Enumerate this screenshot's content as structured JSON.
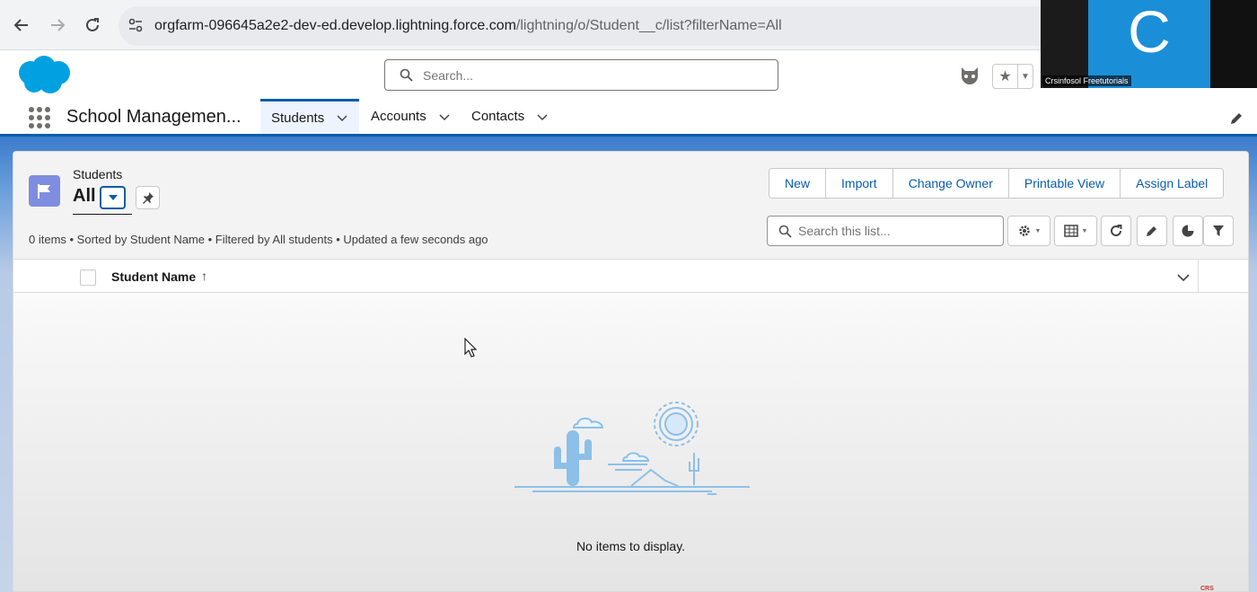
{
  "browser": {
    "url_main": "orgfarm-096645a2e2-dev-ed.develop.lightning.force.com",
    "url_path": "/lightning/o/Student__c/list?filterName=All"
  },
  "header": {
    "search_placeholder": "Search..."
  },
  "video_overlay": {
    "initial": "C",
    "name": "Crsinfosol Freetutorials"
  },
  "app_nav": {
    "app_name": "School Managemen...",
    "tabs": [
      {
        "label": "Students",
        "active": true
      },
      {
        "label": "Accounts",
        "active": false
      },
      {
        "label": "Contacts",
        "active": false
      }
    ]
  },
  "list_view": {
    "object_label": "Students",
    "view_name": "All",
    "info": "0 items • Sorted by Student Name • Filtered by All students • Updated a few seconds ago",
    "actions": [
      "New",
      "Import",
      "Change Owner",
      "Printable View",
      "Assign Label"
    ],
    "search_placeholder": "Search this list...",
    "columns": [
      {
        "label": "Student Name",
        "sort": "ascending"
      }
    ],
    "sort_arrow": "↑",
    "empty_message": "No items to display."
  },
  "watermark": "CRS",
  "colors": {
    "brand_blue": "#0b5cab",
    "object_icon": "#7f8de1",
    "salesforce_cloud": "#00a1e0",
    "illustration": "#8cc0e8"
  },
  "icons": [
    "back-arrow-icon",
    "forward-arrow-icon",
    "reload-icon",
    "site-info-icon",
    "salesforce-logo",
    "search-icon",
    "trailhead-icon",
    "star-icon",
    "app-launcher-icon",
    "chevron-down-icon",
    "pencil-icon",
    "flag-icon",
    "pin-icon",
    "gear-icon",
    "table-icon",
    "refresh-icon",
    "chart-icon",
    "filter-icon",
    "cursor-icon"
  ]
}
